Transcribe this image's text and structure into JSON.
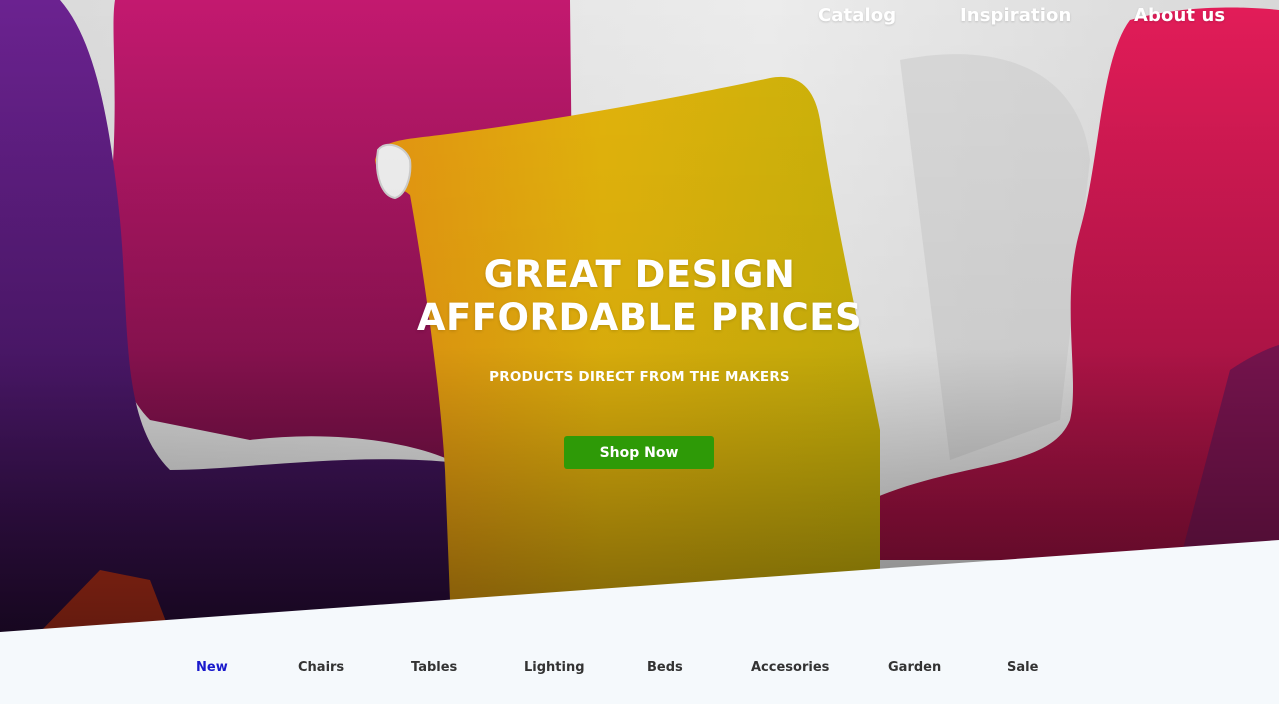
{
  "top_nav": {
    "items": [
      {
        "label": "Catalog"
      },
      {
        "label": "Inspiration"
      },
      {
        "label": "About us"
      }
    ]
  },
  "hero": {
    "headline_line1": "GREAT DESIGN",
    "headline_line2": "AFFORDABLE PRICES",
    "subheadline": "PRODUCTS DIRECT FROM THE MAKERS",
    "cta_label": "Shop Now",
    "colors": {
      "cta": "#2e9a07",
      "purple_chair": "#4b1a66",
      "magenta_chair": "#b01a6a",
      "yellow_chair": "#d8b60a",
      "red_chair": "#d41a55"
    }
  },
  "category_nav": {
    "active_index": 0,
    "active_color": "#1a1acc",
    "items": [
      {
        "label": "New"
      },
      {
        "label": "Chairs"
      },
      {
        "label": "Tables"
      },
      {
        "label": "Lighting"
      },
      {
        "label": "Beds"
      },
      {
        "label": "Accesories"
      },
      {
        "label": "Garden"
      },
      {
        "label": "Sale"
      }
    ]
  }
}
